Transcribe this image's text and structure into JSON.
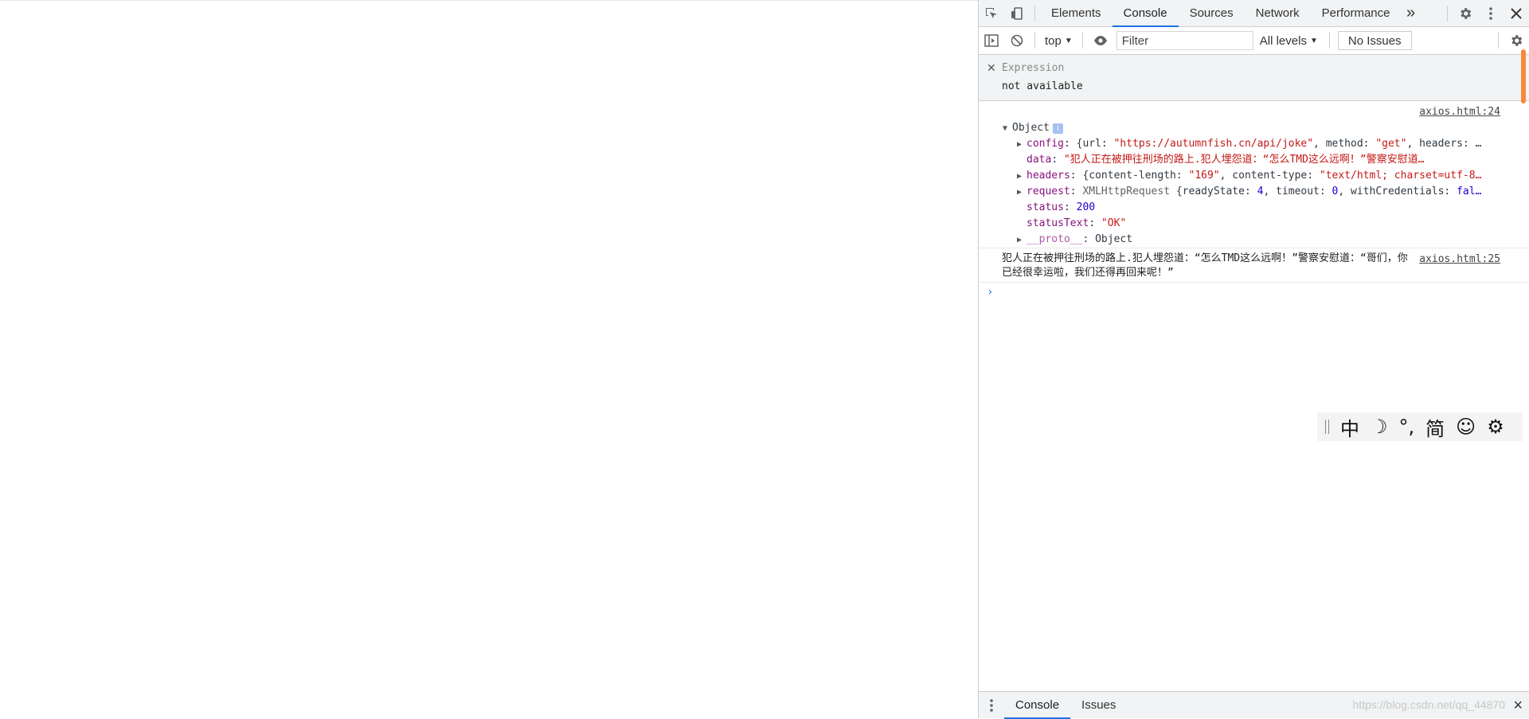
{
  "devtools": {
    "tabs": [
      "Elements",
      "Console",
      "Sources",
      "Network",
      "Performance"
    ],
    "more_tabs": "»"
  },
  "console_toolbar": {
    "context": "top",
    "filter_placeholder": "Filter",
    "levels": "All levels",
    "issues": "No Issues"
  },
  "expression": {
    "label": "Expression",
    "value": "not available"
  },
  "log1": {
    "source": "axios.html:24",
    "title": "Object",
    "config": {
      "key": "config",
      "open": "{url: ",
      "url": "\"https://autumnfish.cn/api/joke\"",
      "method_key": ", method: ",
      "method": "\"get\"",
      "tail": ", headers: …"
    },
    "data": {
      "key": "data",
      "value": "\"犯人正在被押往刑场的路上.犯人埋怨道：“怎么TMD这么远啊！”警察安慰道…"
    },
    "headers": {
      "key": "headers",
      "open": "{content-length: ",
      "length": "\"169\"",
      "type_key": ", content-type: ",
      "type": "\"text/html; charset=utf-8…"
    },
    "request": {
      "key": "request",
      "class": "XMLHttpRequest",
      "open": " {readyState: ",
      "ready": "4",
      "timeout_key": ", timeout: ",
      "timeout": "0",
      "cred_key": ", withCredentials: ",
      "cred": "fal…"
    },
    "status": {
      "key": "status",
      "value": "200"
    },
    "statusText": {
      "key": "statusText",
      "value": "\"OK\""
    },
    "proto": {
      "key": "__proto__",
      "value": "Object"
    }
  },
  "log2": {
    "source": "axios.html:25",
    "text": "犯人正在被押往刑场的路上.犯人埋怨道：“怎么TMD这么远啊！”警察安慰道：“哥们，你已经很幸运啦，我们还得再回来呢！”"
  },
  "prompt": "›",
  "ime": [
    "中",
    "☽",
    "°,",
    "简",
    "☺",
    "⚙"
  ],
  "drawer": {
    "tabs": [
      "Console",
      "Issues"
    ],
    "watermark": "https://blog.csdn.net/qq_44870"
  }
}
